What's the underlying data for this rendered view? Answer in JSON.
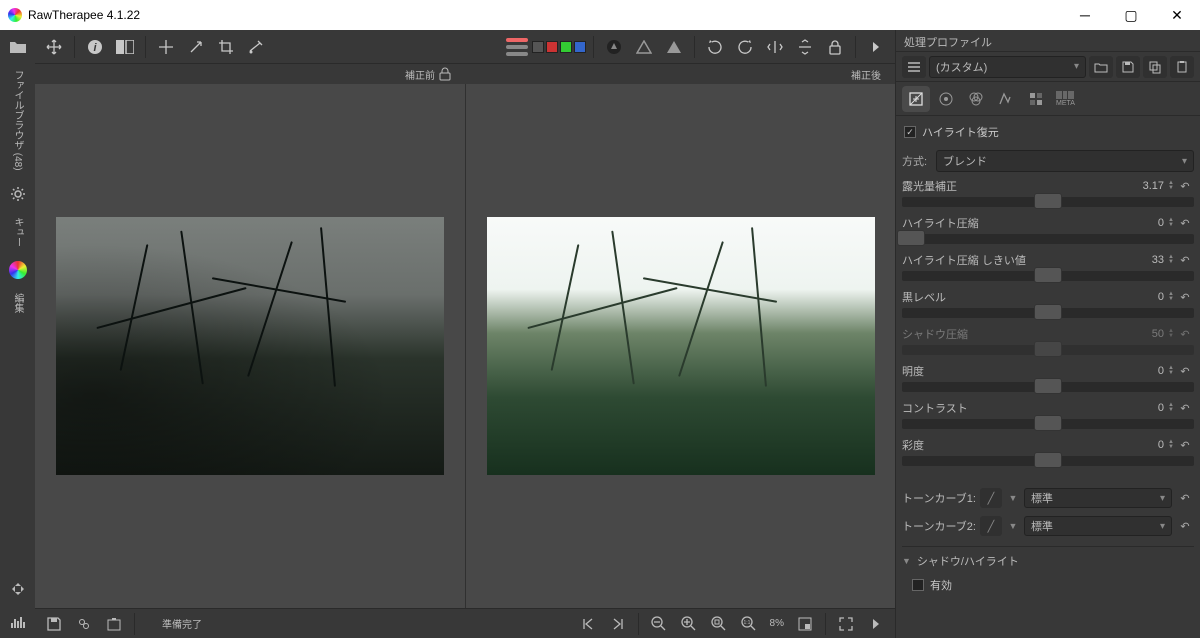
{
  "title": "RawTherapee 4.1.22",
  "leftbar": {
    "tab_filebrowser": "ファイルブラウザ (48)",
    "tab_queue": "キュー",
    "tab_editor": "編集"
  },
  "preview": {
    "before_label": "補正前",
    "after_label": "補正後"
  },
  "status": {
    "ready": "準備完了",
    "zoom": "8%"
  },
  "right": {
    "panel_title": "処理プロファイル",
    "profile_combo": "(カスタム)",
    "highlight_recovery": {
      "label": "ハイライト復元",
      "checked": true
    },
    "method": {
      "label": "方式:",
      "value": "ブレンド"
    },
    "sliders": {
      "exposure": {
        "label": "露光量補正",
        "value": "3.17",
        "pos": 50
      },
      "hl_compress": {
        "label": "ハイライト圧縮",
        "value": "0",
        "pos": 3
      },
      "hl_threshold": {
        "label": "ハイライト圧縮 しきい値",
        "value": "33",
        "pos": 50
      },
      "black": {
        "label": "黒レベル",
        "value": "0",
        "pos": 50
      },
      "shadow_compress": {
        "label": "シャドウ圧縮",
        "value": "50",
        "pos": 50,
        "disabled": true
      },
      "lightness": {
        "label": "明度",
        "value": "0",
        "pos": 50
      },
      "contrast": {
        "label": "コントラスト",
        "value": "0",
        "pos": 50
      },
      "saturation": {
        "label": "彩度",
        "value": "0",
        "pos": 50
      }
    },
    "curve1": {
      "label": "トーンカーブ1:",
      "mode": "標準"
    },
    "curve2": {
      "label": "トーンカーブ2:",
      "mode": "標準"
    },
    "shadow_highlight": {
      "header": "シャドウ/ハイライト",
      "enable_label": "有効",
      "enabled": false
    }
  },
  "meta_tab_label": "META"
}
